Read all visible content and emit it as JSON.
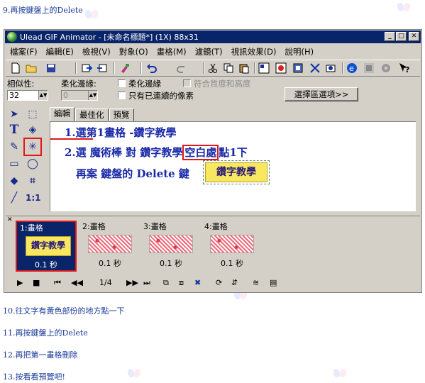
{
  "steps": {
    "step9": "9.再按鍵盤上的Delete",
    "step10": "10.往文字有黃色部份的地方點一下",
    "step11": "11.再按鍵盤上的Delete",
    "step12": "12.再把第一畫格刪除",
    "step13": "13.按看看預覽吧!"
  },
  "window": {
    "title": "Ulead GIF Animator - [未命名標題*] (1X) 88x31",
    "buttons": {
      "minimize": "_",
      "maximize": "□",
      "close": "✕"
    }
  },
  "menu": [
    "檔案(F)",
    "編輯(E)",
    "檢視(V)",
    "對象(O)",
    "畫格(M)",
    "濾鏡(T)",
    "視訊效果(D)",
    "說明(H)"
  ],
  "toolbar_icons": [
    "new-file-icon",
    "open-folder-icon",
    "save-icon",
    "import-icon",
    "export-icon",
    "paint-icon",
    "undo-icon",
    "redo-icon",
    "cut-icon",
    "copy-icon",
    "paste-icon",
    "optimize-icon",
    "preview-icon",
    "frame-icon",
    "tween-icon",
    "filter-icon",
    "browser-icon",
    "globe-icon",
    "gear-icon",
    "help-icon"
  ],
  "props": {
    "similarity_label": "相似性:",
    "similarity_value": "32",
    "feather_label": "柔化邊緣:",
    "feather_value": "0",
    "antialias_label": "柔化邊緣",
    "match_label": "符合質度和高度",
    "contiguous_label": "只有已連續的像素",
    "selection_button": "選擇區選項>>"
  },
  "tabs": [
    "編輯",
    "最佳化",
    "預覽"
  ],
  "canvas": {
    "line1": "1.選第1畫格 -鑽字教學",
    "line2a": "2.選 魔術棒 對 鑽字教學",
    "line2b": "空白處",
    "line2c": "點1下",
    "line3": "再案 鍵盤的 Delete 鍵",
    "badge": "鑽字教學"
  },
  "frames": [
    {
      "label": "1:畫格",
      "delay": "0.1 秒",
      "badge": "鑽字教學"
    },
    {
      "label": "2:畫格",
      "delay": "0.1 秒"
    },
    {
      "label": "3:畫格",
      "delay": "0.1 秒"
    },
    {
      "label": "4:畫格",
      "delay": "0.1 秒"
    }
  ],
  "playbar": {
    "counter": "1/4"
  },
  "colors": {
    "titlebar": "#0a246a",
    "annotation": "#1a2aa8",
    "highlight": "#e01818",
    "badge": "#f8e860"
  }
}
